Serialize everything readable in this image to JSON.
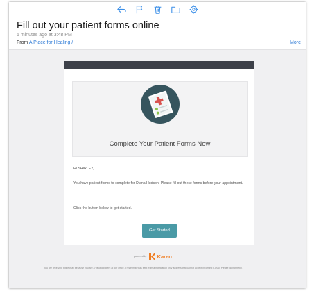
{
  "toolbar": {
    "icons": [
      "reply-icon",
      "flag-icon",
      "trash-icon",
      "folder-icon",
      "settings-icon"
    ],
    "color": "#3b8fe8"
  },
  "message": {
    "subject": "Fill out your patient forms online",
    "time": "5 minutes ago at 3:48 PM",
    "from_label": "From",
    "from_name": "A Place for Healing",
    "from_suffix": "/",
    "more_label": "More"
  },
  "email": {
    "hero_title": "Complete Your Patient Forms Now",
    "greeting": "Hi SHIRLEY,",
    "paragraph1": "You have patient forms to complete for Diana Hudson. Please fill out these forms before your appointment.",
    "paragraph2": "Click the button below to get started.",
    "cta_label": "Get Started",
    "powered_by": "powered by",
    "brand": "Kareo",
    "footer": "You are receiving this e-mail because you are a valued patient at our office. This e-mail was sent from a notification only address that cannot accept incoming e-mail. Please do not reply."
  },
  "colors": {
    "accent": "#4a9aa6",
    "link": "#2f7bd6",
    "header_bar": "#3d4049",
    "brand": "#f07d22"
  }
}
